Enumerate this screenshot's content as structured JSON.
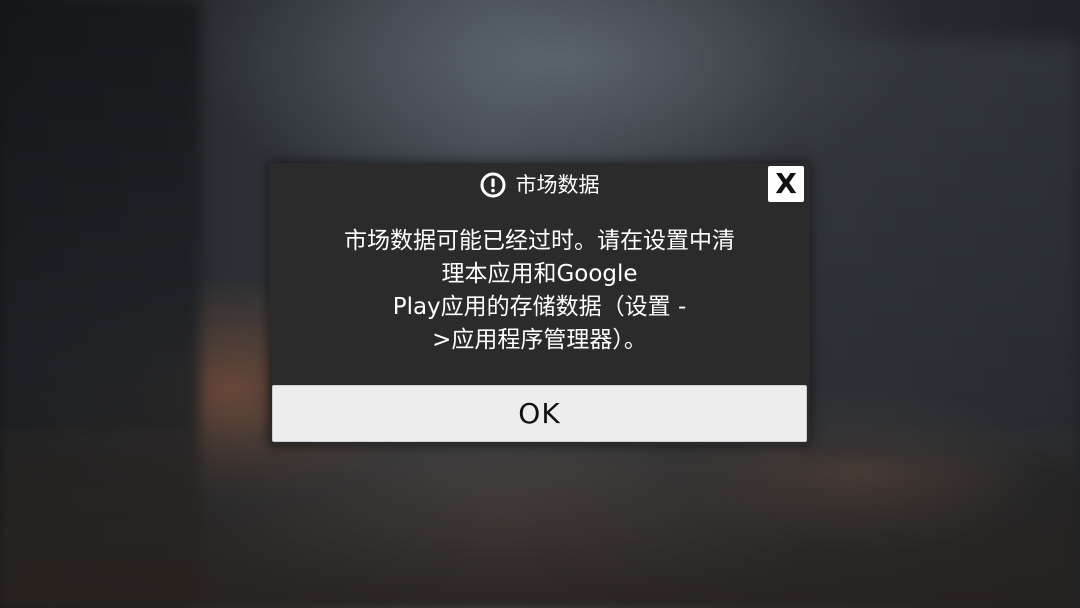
{
  "dialog": {
    "title": "市场数据",
    "title_icon": "alert-circle-icon",
    "close_label": "X",
    "message_lines": [
      "市场数据可能已经过时。请在设置中清",
      "理本应用和Google",
      "Play应用的存储数据（设置 -",
      ">应用程序管理器）。"
    ],
    "ok_label": "OK"
  },
  "colors": {
    "dialog_bg": "#2b2b2b",
    "button_bg": "#ededed",
    "text_light": "#ffffff",
    "text_dark": "#111111"
  }
}
